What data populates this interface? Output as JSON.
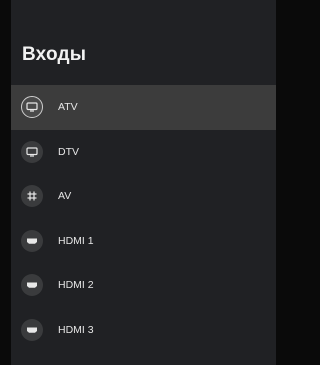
{
  "header": {
    "title": "Входы"
  },
  "inputs": [
    {
      "label": "ATV",
      "icon": "tv-icon",
      "selected": true
    },
    {
      "label": "DTV",
      "icon": "tv-icon",
      "selected": false
    },
    {
      "label": "AV",
      "icon": "av-jack-icon",
      "selected": false
    },
    {
      "label": "HDMI 1",
      "icon": "hdmi-icon",
      "selected": false
    },
    {
      "label": "HDMI 2",
      "icon": "hdmi-icon",
      "selected": false
    },
    {
      "label": "HDMI 3",
      "icon": "hdmi-icon",
      "selected": false
    }
  ],
  "colors": {
    "panel": "#202124",
    "selected_row": "#3c3c3c",
    "text": "#e6e6e6"
  }
}
